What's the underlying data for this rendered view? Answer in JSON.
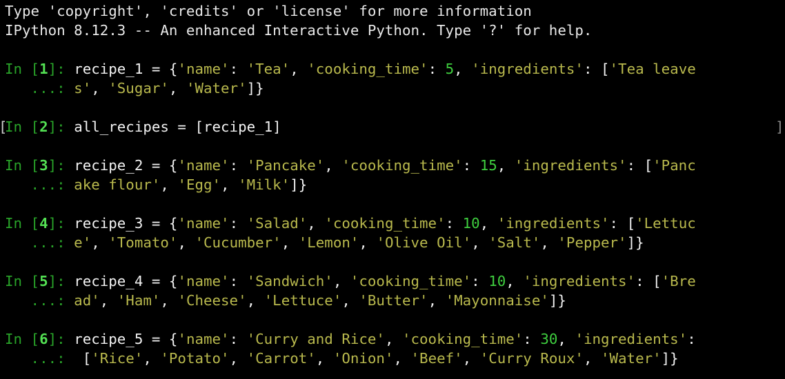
{
  "header": {
    "line1": "Type 'copyright', 'credits' or 'license' for more information",
    "line2": "IPython 8.12.3 -- An enhanced Interactive Python. Type '?' for help."
  },
  "prompt": {
    "in_label": "In [",
    "close": "]: ",
    "continuation": "   ...: "
  },
  "cells": [
    {
      "number": "1",
      "line1": [
        {
          "t": "code",
          "v": "recipe_1 = {"
        },
        {
          "t": "str",
          "v": "'name'"
        },
        {
          "t": "code",
          "v": ": "
        },
        {
          "t": "str",
          "v": "'Tea'"
        },
        {
          "t": "code",
          "v": ", "
        },
        {
          "t": "str",
          "v": "'cooking_time'"
        },
        {
          "t": "code",
          "v": ": "
        },
        {
          "t": "num",
          "v": "5"
        },
        {
          "t": "code",
          "v": ", "
        },
        {
          "t": "str",
          "v": "'ingredients'"
        },
        {
          "t": "code",
          "v": ": ["
        },
        {
          "t": "str",
          "v": "'Tea leave"
        }
      ],
      "line2": [
        {
          "t": "str",
          "v": "s'"
        },
        {
          "t": "code",
          "v": ", "
        },
        {
          "t": "str",
          "v": "'Sugar'"
        },
        {
          "t": "code",
          "v": ", "
        },
        {
          "t": "str",
          "v": "'Water'"
        },
        {
          "t": "code",
          "v": "]}"
        }
      ]
    },
    {
      "number": "2",
      "active": true,
      "line1": [
        {
          "t": "code",
          "v": "all_recipes = [recipe_1]"
        }
      ]
    },
    {
      "number": "3",
      "line1": [
        {
          "t": "code",
          "v": "recipe_2 = {"
        },
        {
          "t": "str",
          "v": "'name'"
        },
        {
          "t": "code",
          "v": ": "
        },
        {
          "t": "str",
          "v": "'Pancake'"
        },
        {
          "t": "code",
          "v": ", "
        },
        {
          "t": "str",
          "v": "'cooking_time'"
        },
        {
          "t": "code",
          "v": ": "
        },
        {
          "t": "num",
          "v": "15"
        },
        {
          "t": "code",
          "v": ", "
        },
        {
          "t": "str",
          "v": "'ingredients'"
        },
        {
          "t": "code",
          "v": ": ["
        },
        {
          "t": "str",
          "v": "'Panc"
        }
      ],
      "line2": [
        {
          "t": "str",
          "v": "ake flour'"
        },
        {
          "t": "code",
          "v": ", "
        },
        {
          "t": "str",
          "v": "'Egg'"
        },
        {
          "t": "code",
          "v": ", "
        },
        {
          "t": "str",
          "v": "'Milk'"
        },
        {
          "t": "code",
          "v": "]}"
        }
      ]
    },
    {
      "number": "4",
      "line1": [
        {
          "t": "code",
          "v": "recipe_3 = {"
        },
        {
          "t": "str",
          "v": "'name'"
        },
        {
          "t": "code",
          "v": ": "
        },
        {
          "t": "str",
          "v": "'Salad'"
        },
        {
          "t": "code",
          "v": ", "
        },
        {
          "t": "str",
          "v": "'cooking_time'"
        },
        {
          "t": "code",
          "v": ": "
        },
        {
          "t": "num",
          "v": "10"
        },
        {
          "t": "code",
          "v": ", "
        },
        {
          "t": "str",
          "v": "'ingredients'"
        },
        {
          "t": "code",
          "v": ": ["
        },
        {
          "t": "str",
          "v": "'Lettuc"
        }
      ],
      "line2": [
        {
          "t": "str",
          "v": "e'"
        },
        {
          "t": "code",
          "v": ", "
        },
        {
          "t": "str",
          "v": "'Tomato'"
        },
        {
          "t": "code",
          "v": ", "
        },
        {
          "t": "str",
          "v": "'Cucumber'"
        },
        {
          "t": "code",
          "v": ", "
        },
        {
          "t": "str",
          "v": "'Lemon'"
        },
        {
          "t": "code",
          "v": ", "
        },
        {
          "t": "str",
          "v": "'Olive Oil'"
        },
        {
          "t": "code",
          "v": ", "
        },
        {
          "t": "str",
          "v": "'Salt'"
        },
        {
          "t": "code",
          "v": ", "
        },
        {
          "t": "str",
          "v": "'Pepper'"
        },
        {
          "t": "code",
          "v": "]}"
        }
      ]
    },
    {
      "number": "5",
      "line1": [
        {
          "t": "code",
          "v": "recipe_4 = {"
        },
        {
          "t": "str",
          "v": "'name'"
        },
        {
          "t": "code",
          "v": ": "
        },
        {
          "t": "str",
          "v": "'Sandwich'"
        },
        {
          "t": "code",
          "v": ", "
        },
        {
          "t": "str",
          "v": "'cooking_time'"
        },
        {
          "t": "code",
          "v": ": "
        },
        {
          "t": "num",
          "v": "10"
        },
        {
          "t": "code",
          "v": ", "
        },
        {
          "t": "str",
          "v": "'ingredients'"
        },
        {
          "t": "code",
          "v": ": ["
        },
        {
          "t": "str",
          "v": "'Bre"
        }
      ],
      "line2": [
        {
          "t": "str",
          "v": "ad'"
        },
        {
          "t": "code",
          "v": ", "
        },
        {
          "t": "str",
          "v": "'Ham'"
        },
        {
          "t": "code",
          "v": ", "
        },
        {
          "t": "str",
          "v": "'Cheese'"
        },
        {
          "t": "code",
          "v": ", "
        },
        {
          "t": "str",
          "v": "'Lettuce'"
        },
        {
          "t": "code",
          "v": ", "
        },
        {
          "t": "str",
          "v": "'Butter'"
        },
        {
          "t": "code",
          "v": ", "
        },
        {
          "t": "str",
          "v": "'Mayonnaise'"
        },
        {
          "t": "code",
          "v": "]}"
        }
      ]
    },
    {
      "number": "6",
      "line1": [
        {
          "t": "code",
          "v": "recipe_5 = {"
        },
        {
          "t": "str",
          "v": "'name'"
        },
        {
          "t": "code",
          "v": ": "
        },
        {
          "t": "str",
          "v": "'Curry and Rice'"
        },
        {
          "t": "code",
          "v": ", "
        },
        {
          "t": "str",
          "v": "'cooking_time'"
        },
        {
          "t": "code",
          "v": ": "
        },
        {
          "t": "num",
          "v": "30"
        },
        {
          "t": "code",
          "v": ", "
        },
        {
          "t": "str",
          "v": "'ingredients'"
        },
        {
          "t": "code",
          "v": ":"
        }
      ],
      "line2": [
        {
          "t": "code",
          "v": " ["
        },
        {
          "t": "str",
          "v": "'Rice'"
        },
        {
          "t": "code",
          "v": ", "
        },
        {
          "t": "str",
          "v": "'Potato'"
        },
        {
          "t": "code",
          "v": ", "
        },
        {
          "t": "str",
          "v": "'Carrot'"
        },
        {
          "t": "code",
          "v": ", "
        },
        {
          "t": "str",
          "v": "'Onion'"
        },
        {
          "t": "code",
          "v": ", "
        },
        {
          "t": "str",
          "v": "'Beef'"
        },
        {
          "t": "code",
          "v": ", "
        },
        {
          "t": "str",
          "v": "'Curry Roux'"
        },
        {
          "t": "code",
          "v": ", "
        },
        {
          "t": "str",
          "v": "'Water'"
        },
        {
          "t": "code",
          "v": "]}"
        }
      ]
    }
  ],
  "active_markers": {
    "left": "[",
    "right": "]"
  },
  "colors": {
    "background": "#000000",
    "text": "#f2f2f2",
    "prompt": "#29a329",
    "prompt_number": "#53e053",
    "string": "#b9b94d",
    "number": "#3fcf3f"
  }
}
